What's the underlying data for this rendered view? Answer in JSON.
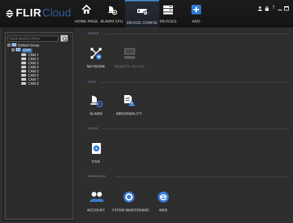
{
  "app": {
    "brand": "FLIR",
    "brand_sub": "Cloud"
  },
  "nav": [
    {
      "label": "HOME PAGE",
      "icon": "home-icon"
    },
    {
      "label": "ALARM CFG",
      "icon": "alarm-config-icon"
    },
    {
      "label": "DEVICE CONFIG",
      "icon": "device-config-icon"
    },
    {
      "label": "DEVICES",
      "icon": "devices-icon"
    },
    {
      "label": "ADD",
      "icon": "add-icon"
    }
  ],
  "window_controls": [
    "person-icon",
    "lock-icon",
    "help-icon",
    "minimize-icon",
    "maximize-icon"
  ],
  "help_glyph": "?",
  "tree": {
    "search_placeholder": "Input search criteria",
    "group": "Default Group",
    "device": "DVR",
    "cameras": [
      "CAM 1",
      "CAM 2",
      "CAM 3",
      "CAM 4",
      "CAM 5",
      "CAM 6",
      "CAM 7",
      "CAM 8"
    ]
  },
  "sections": [
    {
      "title": "General",
      "items": [
        {
          "label": "NETWORK",
          "icon": "network-icon",
          "enabled": true
        },
        {
          "label": "REMOTE DEVICE",
          "icon": "remote-device-icon",
          "enabled": false
        }
      ]
    },
    {
      "title": "Event",
      "items": [
        {
          "label": "ALARM",
          "icon": "alarm-icon",
          "enabled": true
        },
        {
          "label": "ABNORMALITY",
          "icon": "abnormality-icon",
          "enabled": true
        }
      ]
    },
    {
      "title": "Record",
      "items": [
        {
          "label": "DISK",
          "icon": "disk-icon",
          "enabled": true
        }
      ]
    },
    {
      "title": "Maintenance",
      "items": [
        {
          "label": "ACCOUNT",
          "icon": "account-icon",
          "enabled": true
        },
        {
          "label": "YSTEM MAINTENANC",
          "icon": "system-maintenance-icon",
          "enabled": true
        },
        {
          "label": "WEB",
          "icon": "web-icon",
          "enabled": true
        }
      ]
    }
  ],
  "colors": {
    "accent": "#3b7dd8",
    "section_title": "#6f8db8",
    "background": "#2e2e2e",
    "topbar": "#161616"
  }
}
